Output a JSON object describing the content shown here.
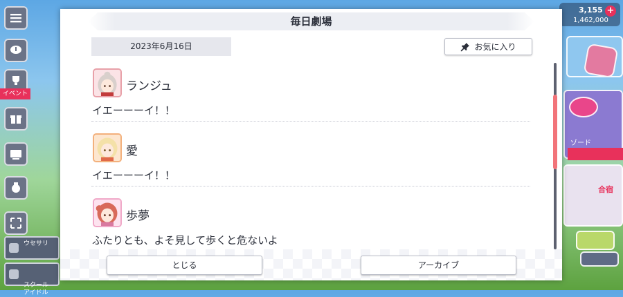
{
  "background": {
    "left_menu": [
      {
        "icon": "hamburger-menu-icon"
      },
      {
        "icon": "chat-bubble-icon"
      },
      {
        "icon": "trophy-cup-icon",
        "tag": "イベント"
      },
      {
        "icon": "gift-icon"
      },
      {
        "icon": "theater-screen-icon"
      },
      {
        "icon": "medal-icon"
      },
      {
        "icon": "expand-icon"
      }
    ],
    "bottom_tiles": [
      {
        "label": "ウセサリ"
      },
      {
        "label": "スクール\nアイドル"
      }
    ],
    "currency": {
      "primary": "3,155",
      "secondary": "1,462,000",
      "plus": "+"
    },
    "right_tiles": [
      {
        "label": ""
      },
      {
        "label": "ゾード"
      },
      {
        "label": "合宿"
      }
    ]
  },
  "dialog": {
    "title": "毎日劇場",
    "date": "2023年6月16日",
    "favorite_label": "お気に入り",
    "entries": [
      {
        "speaker": "ランジュ",
        "line": "イエーーーイ！！",
        "avatar_color": "#e8a0a8",
        "hair": "#d9d0cc"
      },
      {
        "speaker": "愛",
        "line": "イエーーーイ！！",
        "avatar_color": "#f3b07c",
        "hair": "#f4e1a8"
      },
      {
        "speaker": "歩夢",
        "line": "ふたりとも、よそ見して歩くと危ないよ",
        "avatar_color": "#f0a8c8",
        "hair": "#d86a5a"
      }
    ],
    "close_label": "とじる",
    "archive_label": "アーカイブ"
  },
  "colors": {
    "accent": "#f2747a",
    "text": "#2b2f3a",
    "event_tag": "#e8315b"
  }
}
